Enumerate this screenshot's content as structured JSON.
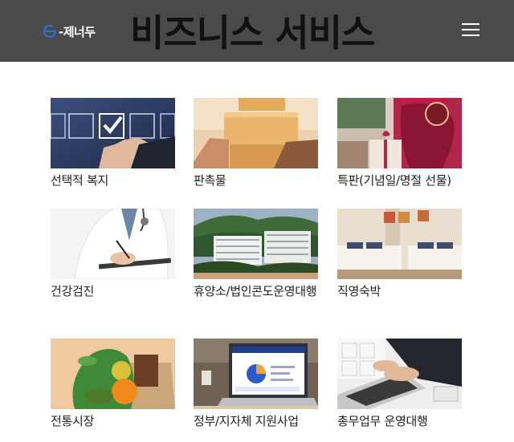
{
  "header": {
    "logo_text": "-제너두",
    "title": "비즈니스 서비스"
  },
  "services": [
    {
      "label": "선택적 복지",
      "image": "checkbox-selection"
    },
    {
      "label": "판촉물",
      "image": "parcel-boxes"
    },
    {
      "label": "특판(기념일/명절 선물)",
      "image": "gift-boxes"
    },
    {
      "label": "건강검진",
      "image": "doctor-writing"
    },
    {
      "label": "휴양소/법인콘도운영대행",
      "image": "mountain-resort"
    },
    {
      "label": "직영숙박",
      "image": "hotel-room"
    },
    {
      "label": "전통시장",
      "image": "grocery-bag"
    },
    {
      "label": "정부/지자체 지원사업",
      "image": "laptop-dashboard"
    },
    {
      "label": "총무업무 운영대행",
      "image": "typing-laptop"
    }
  ]
}
